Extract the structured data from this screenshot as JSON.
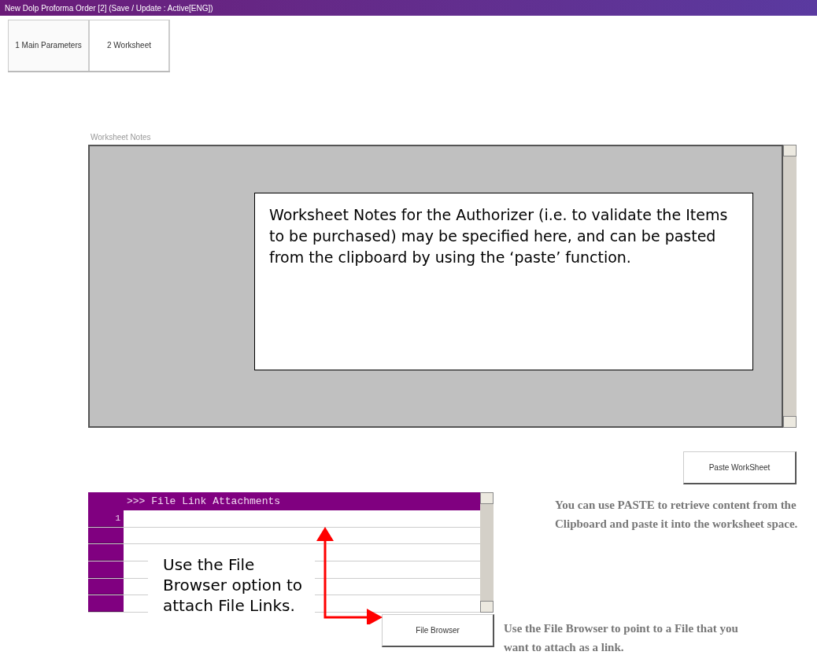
{
  "window": {
    "title": "New Dolp Proforma Order [2]   (Save / Update : Active[ENG])"
  },
  "tabs": [
    {
      "label": "1 Main Parameters",
      "selected": false
    },
    {
      "label": "2 Worksheet",
      "selected": true
    }
  ],
  "worksheet_notes": {
    "label": "Worksheet Notes",
    "callout": "Worksheet Notes for the Authorizer (i.e. to validate the Items to be purchased) may be specified here, and can be pasted from the clipboard by using the ‘paste’ function."
  },
  "paste_button": "Paste WorkSheet",
  "paste_help": "You can use PASTE to retrieve content from the Clipboard and paste it into the worksheet space.",
  "attachments": {
    "header": ">>> File Link Attachments",
    "rows": [
      {
        "number": "1"
      }
    ],
    "callout": "Use the File Browser option to attach File Links."
  },
  "file_browser_button": "File Browser",
  "file_browser_help": "Use the File Browser to point to a File that you want to attach as a link."
}
